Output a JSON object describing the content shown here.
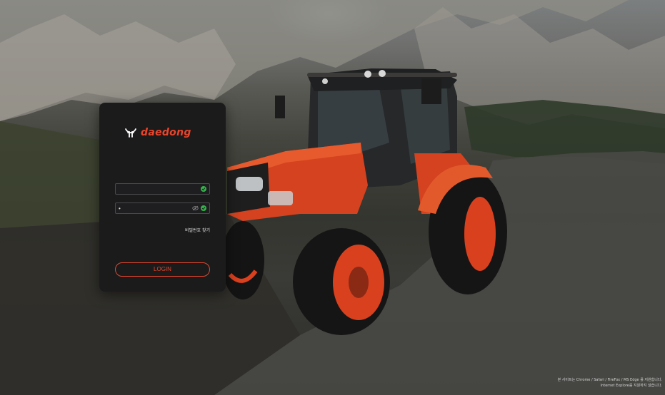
{
  "brand": {
    "name": "daedong",
    "accent_color": "#e8452b"
  },
  "login_form": {
    "id_field": {
      "value": "",
      "placeholder": "",
      "status_icon": "check-circle-icon"
    },
    "password_field": {
      "value": "•",
      "placeholder": "",
      "toggle_icon": "eye-slash-icon",
      "status_icon": "check-circle-icon"
    },
    "find_password_label": "비밀번호 찾기",
    "login_button_label": "LOGIN"
  },
  "notice": {
    "line1": "본 사이트는 Chrome / Safari / FireFox / MS Edge 를 지원합니다.",
    "line2": "Internet Explore를 지원하지 않습니다."
  }
}
